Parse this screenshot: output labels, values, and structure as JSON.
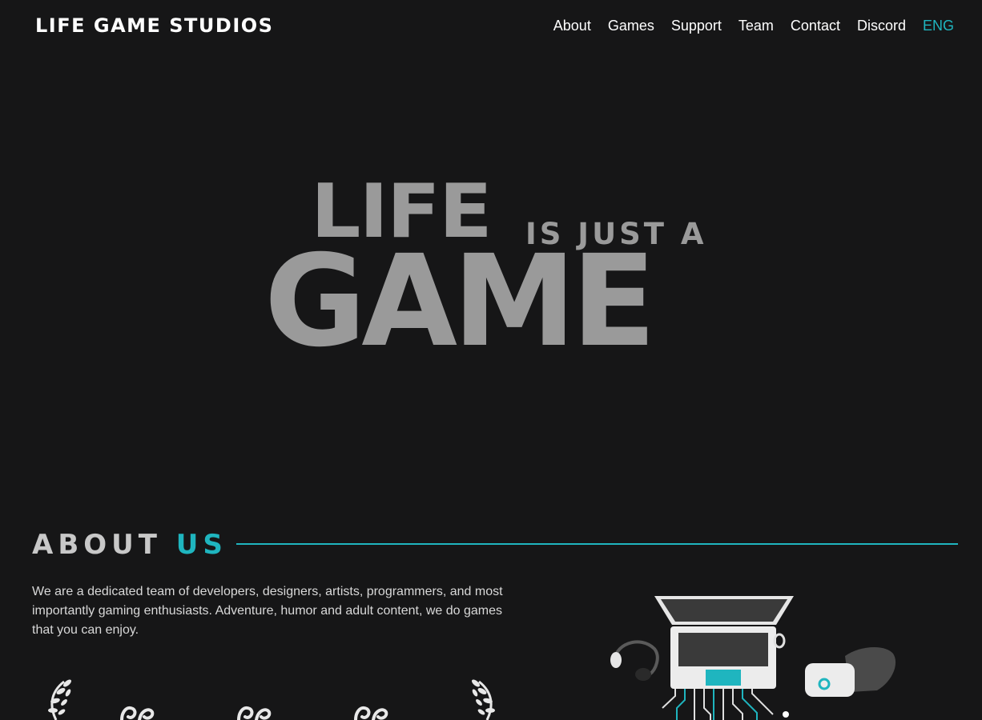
{
  "header": {
    "logo": "LIFE GAME STUDIOS",
    "nav": [
      {
        "label": "About"
      },
      {
        "label": "Games"
      },
      {
        "label": "Support"
      },
      {
        "label": "Team"
      },
      {
        "label": "Contact"
      },
      {
        "label": "Discord"
      },
      {
        "label": "ENG",
        "active": true
      }
    ]
  },
  "hero": {
    "word1": "LIFE",
    "sub": "IS JUST A",
    "word2": "GAME"
  },
  "about": {
    "title_word1": "ABOUT",
    "title_word2": "US",
    "text": "We are a dedicated team of developers, designers, artists, programmers, and most importantly gaming enthusiasts. Adventure, humor and adult content, we do games that you can enjoy."
  },
  "colors": {
    "background": "#161617",
    "accent": "#1fb5bf",
    "hero_text": "#9a9a9a"
  }
}
